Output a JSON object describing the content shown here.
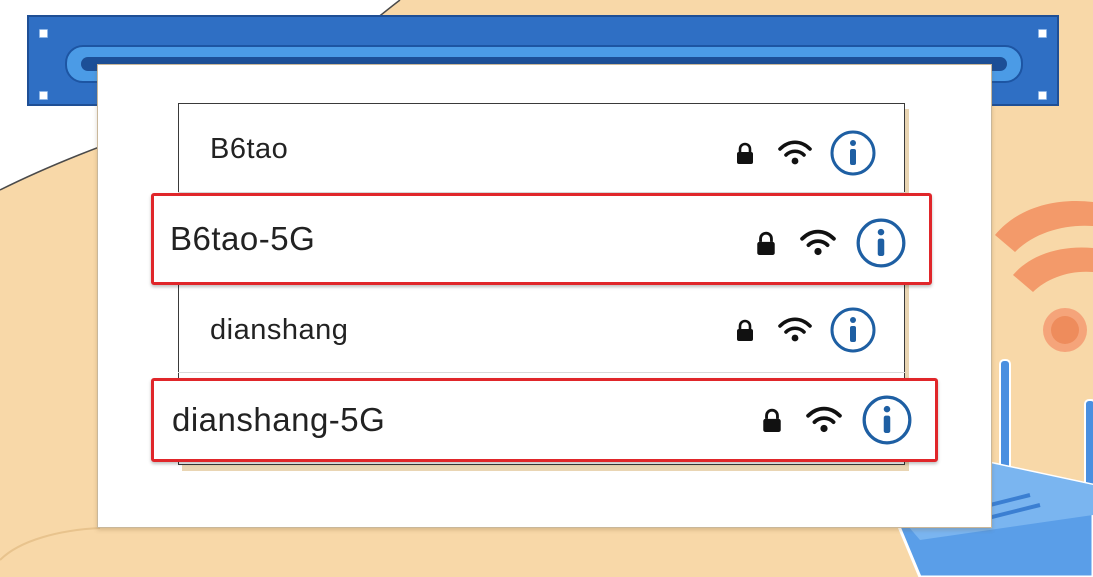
{
  "networks": [
    {
      "ssid": "B6tao",
      "highlighted": false,
      "locked": true,
      "icons": [
        "lock-icon",
        "wifi-icon",
        "info-icon"
      ]
    },
    {
      "ssid": "B6tao-5G",
      "highlighted": true,
      "locked": true,
      "icons": [
        "lock-icon",
        "wifi-icon",
        "info-icon"
      ]
    },
    {
      "ssid": "dianshang",
      "highlighted": false,
      "locked": true,
      "icons": [
        "lock-icon",
        "wifi-icon",
        "info-icon"
      ]
    },
    {
      "ssid": "dianshang-5G",
      "highlighted": true,
      "locked": true,
      "icons": [
        "lock-icon",
        "wifi-icon",
        "info-icon"
      ]
    }
  ],
  "colors": {
    "background": "#f8d8a8",
    "rail": "#2f6fc4",
    "highlight_border": "#e0262a",
    "info_icon": "#1e5fa3",
    "wifi_signal_art": "#f08a5d",
    "router": "#4a8fe0"
  }
}
